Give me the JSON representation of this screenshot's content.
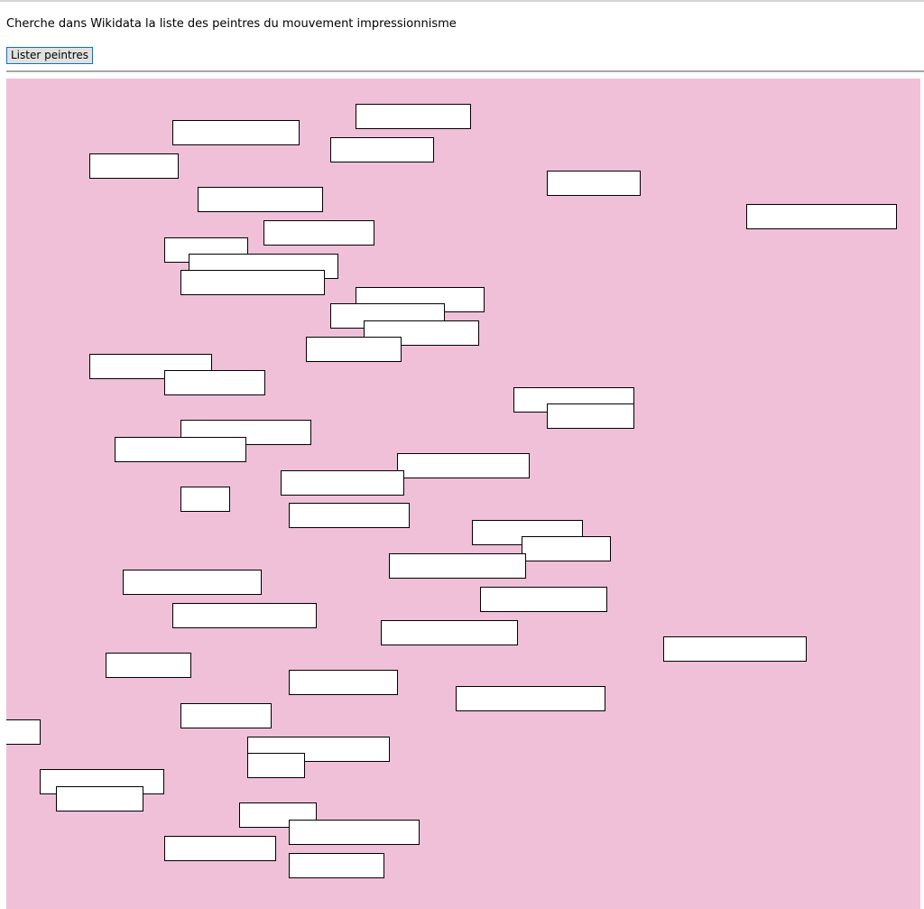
{
  "header": {
    "description": "Cherche dans Wikidata la liste des peintres du mouvement impressionnisme",
    "list_button_label": "Lister peintres"
  },
  "colors": {
    "canvas_background": "#f0c0d8",
    "box_background": "#ffffff",
    "box_border": "#000000",
    "button_border": "#0078d7"
  },
  "canvas": {
    "painter_box_count": 48
  }
}
